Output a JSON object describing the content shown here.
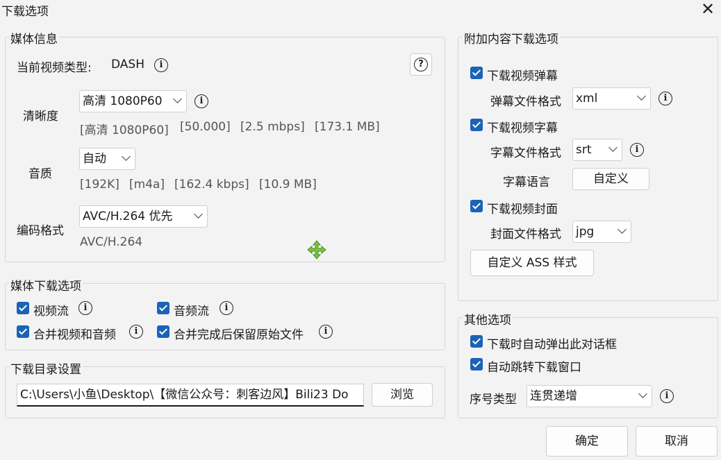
{
  "window": {
    "title": "下载选项",
    "close_symbol": "✕"
  },
  "media_info": {
    "group_title": "媒体信息",
    "video_type_label": "当前视频类型:",
    "video_type_value": "DASH",
    "help_symbol": "?",
    "quality_label": "清晰度",
    "quality_value": "高清 1080P60",
    "quality_details": [
      "[高清 1080P60]",
      "[50.000]",
      "[2.5 mbps]",
      "[173.1 MB]"
    ],
    "audio_label": "音质",
    "audio_value": "自动",
    "audio_details": [
      "[192K]",
      "[m4a]",
      "[162.4 kbps]",
      "[10.9 MB]"
    ],
    "codec_label": "编码格式",
    "codec_value": "AVC/H.264 优先",
    "codec_detail": "AVC/H.264"
  },
  "media_download": {
    "group_title": "媒体下载选项",
    "video_stream": "视频流",
    "audio_stream": "音频流",
    "merge": "合并视频和音频",
    "keep_original": "合并完成后保留原始文件"
  },
  "download_dir": {
    "group_title": "下载目录设置",
    "path_value": "C:\\Users\\小鱼\\Desktop\\【微信公众号：刺客边风】Bili23 Do",
    "browse_label": "浏览"
  },
  "extras": {
    "group_title": "附加内容下载选项",
    "danmaku_checkbox": "下载视频弹幕",
    "danmaku_format_label": "弹幕文件格式",
    "danmaku_format_value": "xml",
    "subtitle_checkbox": "下载视频字幕",
    "subtitle_format_label": "字幕文件格式",
    "subtitle_format_value": "srt",
    "subtitle_lang_label": "字幕语言",
    "subtitle_lang_button": "自定义",
    "cover_checkbox": "下载视频封面",
    "cover_format_label": "封面文件格式",
    "cover_format_value": "jpg",
    "ass_button": "自定义 ASS 样式"
  },
  "other": {
    "group_title": "其他选项",
    "auto_popup": "下载时自动弹出此对话框",
    "auto_jump": "自动跳转下载窗口",
    "seq_label": "序号类型",
    "seq_value": "连贯递增"
  },
  "footer": {
    "ok_label": "确定",
    "cancel_label": "取消"
  },
  "colors": {
    "accent": "#1a63b7",
    "move_cursor": "#7cc243"
  },
  "icons": {
    "info": "info-icon",
    "help": "help-icon",
    "move_cursor": "move-cursor-icon"
  }
}
